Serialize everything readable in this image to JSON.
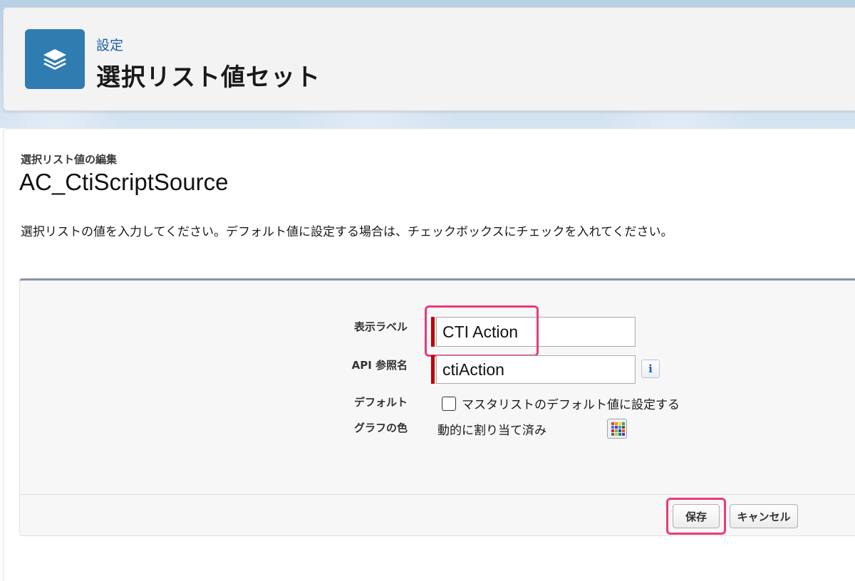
{
  "header": {
    "breadcrumb": "設定",
    "title": "選択リスト値セット",
    "icon": "layers-icon",
    "icon_color": "#2f7cb1"
  },
  "page": {
    "subtitle": "選択リスト値の編集",
    "record_name": "AC_CtiScriptSource",
    "instructions": "選択リストの値を入力してください。デフォルト値に設定する場合は、チェックボックスにチェックを入れてください。"
  },
  "form": {
    "label_field": {
      "label": "表示ラベル",
      "value": "CTI Action"
    },
    "api_field": {
      "label": "API 参照名",
      "value": "ctiAction",
      "info_glyph": "i"
    },
    "default_field": {
      "label": "デフォルト",
      "checkbox_label": "マスタリストのデフォルト値に設定する",
      "checked": false
    },
    "color_field": {
      "label": "グラフの色",
      "value": "動的に割り当て済み",
      "icon": "color-palette-icon"
    }
  },
  "buttons": {
    "save": "保存",
    "cancel": "キャンセル"
  },
  "colors": {
    "required": "#c00000",
    "highlight": "#ec3a7a",
    "link": "#1b5fa8"
  }
}
